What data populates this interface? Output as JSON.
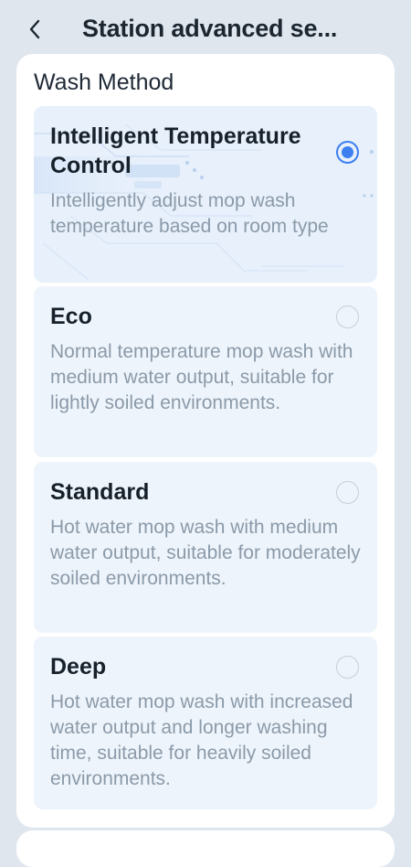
{
  "header": {
    "title": "Station advanced se...",
    "back_icon": "chevron-left-icon"
  },
  "wash_method": {
    "title": "Wash Method",
    "options": [
      {
        "title": "Intelligent Temperature Control",
        "description": "Intelligently adjust mop wash temperature based on room type",
        "selected": true
      },
      {
        "title": "Eco",
        "description": "Normal temperature mop wash with medium water output, suitable for lightly soiled environments.",
        "selected": false
      },
      {
        "title": "Standard",
        "description": "Hot water mop wash with medium water output, suitable for moderately soiled environments.",
        "selected": false
      },
      {
        "title": "Deep",
        "description": "Hot water mop wash with increased water output and longer washing time, suitable for heavily soiled environments.",
        "selected": false
      }
    ]
  },
  "colors": {
    "accent": "#3d7ff0",
    "background": "#dfe6ee",
    "card": "#ffffff",
    "option_bg": "#eef4fb",
    "description_text": "#8b9aa9"
  }
}
